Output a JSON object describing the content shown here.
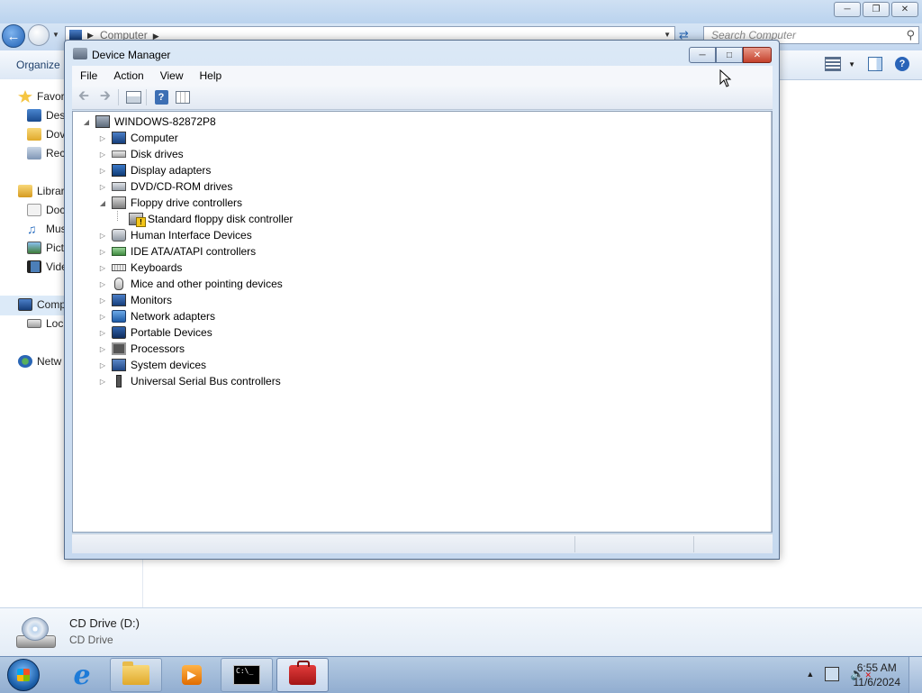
{
  "explorer": {
    "address": {
      "crumb": "Computer"
    },
    "search": {
      "placeholder": "Search Computer"
    },
    "toolbar": {
      "organize": "Organize"
    },
    "nav": [
      {
        "label": "Favor"
      },
      {
        "label": "Des"
      },
      {
        "label": "Dov"
      },
      {
        "label": "Rec"
      },
      {
        "label": "Librar"
      },
      {
        "label": "Doc"
      },
      {
        "label": "Mus"
      },
      {
        "label": "Pict"
      },
      {
        "label": "Vide"
      },
      {
        "label": "Comp"
      },
      {
        "label": "Loc"
      },
      {
        "label": "Netw"
      }
    ],
    "details": {
      "title": "CD Drive (D:)",
      "subtitle": "CD Drive"
    }
  },
  "device_manager": {
    "title": "Device Manager",
    "menu": [
      "File",
      "Action",
      "View",
      "Help"
    ],
    "root": "WINDOWS-82872P8",
    "items": [
      {
        "label": "Computer",
        "icon": "computer-icon"
      },
      {
        "label": "Disk drives",
        "icon": "disk-drive-icon"
      },
      {
        "label": "Display adapters",
        "icon": "display-adapter-icon"
      },
      {
        "label": "DVD/CD-ROM drives",
        "icon": "dvd-drive-icon"
      },
      {
        "label": "Floppy drive controllers",
        "icon": "floppy-controller-icon",
        "expanded": true,
        "children": [
          {
            "label": "Standard floppy disk controller",
            "icon": "floppy-warning-icon"
          }
        ]
      },
      {
        "label": "Human Interface Devices",
        "icon": "hid-icon"
      },
      {
        "label": "IDE ATA/ATAPI controllers",
        "icon": "ide-controller-icon"
      },
      {
        "label": "Keyboards",
        "icon": "keyboard-icon"
      },
      {
        "label": "Mice and other pointing devices",
        "icon": "mouse-icon"
      },
      {
        "label": "Monitors",
        "icon": "monitor-icon"
      },
      {
        "label": "Network adapters",
        "icon": "network-adapter-icon"
      },
      {
        "label": "Portable Devices",
        "icon": "portable-device-icon"
      },
      {
        "label": "Processors",
        "icon": "processor-icon"
      },
      {
        "label": "System devices",
        "icon": "system-device-icon"
      },
      {
        "label": "Universal Serial Bus controllers",
        "icon": "usb-icon"
      }
    ]
  },
  "taskbar": {
    "clock": {
      "time": "6:55 AM",
      "date": "11/6/2024"
    },
    "apps": [
      "internet-explorer-icon",
      "explorer-folder-icon",
      "media-player-icon",
      "command-prompt-icon",
      "device-manager-toolbox-icon"
    ]
  }
}
